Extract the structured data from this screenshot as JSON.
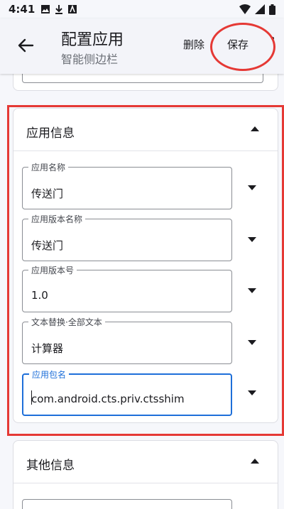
{
  "status_bar": {
    "time": "4:41"
  },
  "app_bar": {
    "title": "配置应用",
    "subtitle": "智能侧边栏",
    "delete_label": "删除",
    "save_label": "保存"
  },
  "app_info": {
    "title": "应用信息",
    "fields": [
      {
        "label": "应用名称",
        "value": "传送门"
      },
      {
        "label": "应用版本名称",
        "value": "传送门"
      },
      {
        "label": "应用版本号",
        "value": "1.0"
      },
      {
        "label": "文本替换·全部文本",
        "value": "计算器"
      },
      {
        "label": "应用包名",
        "value": "com.android.cts.priv.ctsshim"
      }
    ]
  },
  "other_info": {
    "title": "其他信息"
  },
  "colors": {
    "highlight": "#e53935",
    "focus": "#1e6fd9"
  }
}
